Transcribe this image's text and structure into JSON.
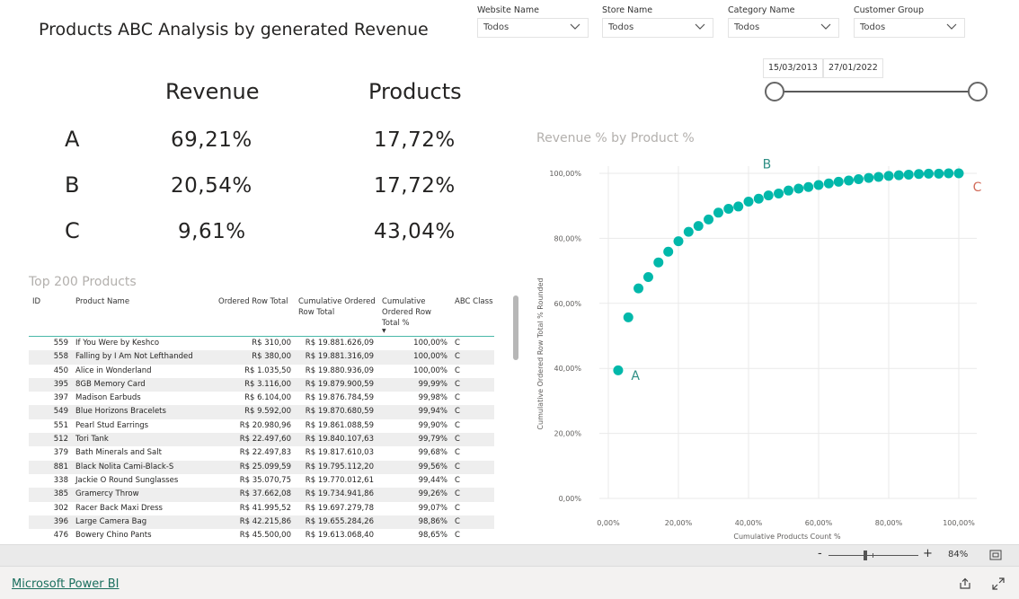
{
  "report": {
    "title": "Products ABC Analysis by generated Revenue"
  },
  "slicers": [
    {
      "label": "Website Name",
      "value": "Todos"
    },
    {
      "label": "Store Name",
      "value": "Todos"
    },
    {
      "label": "Category Name",
      "value": "Todos"
    },
    {
      "label": "Customer Group",
      "value": "Todos"
    }
  ],
  "date_range": {
    "start": "15/03/2013",
    "end": "27/01/2022"
  },
  "kpis": {
    "revenue_header": "Revenue",
    "products_header": "Products",
    "rows": [
      {
        "class": "A",
        "revenue": "69,21%",
        "products": "17,72%"
      },
      {
        "class": "B",
        "revenue": "20,54%",
        "products": "17,72%"
      },
      {
        "class": "C",
        "revenue": "9,61%",
        "products": "43,04%"
      }
    ]
  },
  "table": {
    "title": "Top 200 Products",
    "columns": {
      "id": "ID",
      "name": "Product Name",
      "ordered": "Ordered Row Total",
      "cum_line1": "Cumulative Ordered",
      "cum_line2": "Row Total",
      "pct_line1": "Cumulative",
      "pct_line2": "Ordered Row",
      "pct_line3": "Total %",
      "class": "ABC Class"
    },
    "rows": [
      {
        "id": "559",
        "name": "If You Were by Keshco",
        "ordered": "R$ 310,00",
        "cum": "R$ 19.881.626,09",
        "pct": "100,00%",
        "class": "C"
      },
      {
        "id": "558",
        "name": "Falling by I Am Not Lefthanded",
        "ordered": "R$ 380,00",
        "cum": "R$ 19.881.316,09",
        "pct": "100,00%",
        "class": "C"
      },
      {
        "id": "450",
        "name": "Alice in Wonderland",
        "ordered": "R$ 1.035,50",
        "cum": "R$ 19.880.936,09",
        "pct": "100,00%",
        "class": "C"
      },
      {
        "id": "395",
        "name": "8GB Memory Card",
        "ordered": "R$ 3.116,00",
        "cum": "R$ 19.879.900,59",
        "pct": "99,99%",
        "class": "C"
      },
      {
        "id": "397",
        "name": "Madison Earbuds",
        "ordered": "R$ 6.104,00",
        "cum": "R$ 19.876.784,59",
        "pct": "99,98%",
        "class": "C"
      },
      {
        "id": "549",
        "name": "Blue Horizons Bracelets",
        "ordered": "R$ 9.592,00",
        "cum": "R$ 19.870.680,59",
        "pct": "99,94%",
        "class": "C"
      },
      {
        "id": "551",
        "name": "Pearl Stud Earrings",
        "ordered": "R$ 20.980,96",
        "cum": "R$ 19.861.088,59",
        "pct": "99,90%",
        "class": "C"
      },
      {
        "id": "512",
        "name": "Tori Tank",
        "ordered": "R$ 22.497,60",
        "cum": "R$ 19.840.107,63",
        "pct": "99,79%",
        "class": "C"
      },
      {
        "id": "379",
        "name": "Bath Minerals and Salt",
        "ordered": "R$ 22.497,83",
        "cum": "R$ 19.817.610,03",
        "pct": "99,68%",
        "class": "C"
      },
      {
        "id": "881",
        "name": "Black Nolita Cami-Black-S",
        "ordered": "R$ 25.099,59",
        "cum": "R$ 19.795.112,20",
        "pct": "99,56%",
        "class": "C"
      },
      {
        "id": "338",
        "name": "Jackie O Round Sunglasses",
        "ordered": "R$ 35.070,75",
        "cum": "R$ 19.770.012,61",
        "pct": "99,44%",
        "class": "C"
      },
      {
        "id": "385",
        "name": "Gramercy Throw",
        "ordered": "R$ 37.662,08",
        "cum": "R$ 19.734.941,86",
        "pct": "99,26%",
        "class": "C"
      },
      {
        "id": "302",
        "name": "Racer Back Maxi Dress",
        "ordered": "R$ 41.995,52",
        "cum": "R$ 19.697.279,78",
        "pct": "99,07%",
        "class": "C"
      },
      {
        "id": "396",
        "name": "Large Camera Bag",
        "ordered": "R$ 42.215,86",
        "cum": "R$ 19.655.284,26",
        "pct": "98,86%",
        "class": "C"
      },
      {
        "id": "476",
        "name": "Bowery Chino Pants",
        "ordered": "R$ 45.500,00",
        "cum": "R$ 19.613.068,40",
        "pct": "98,65%",
        "class": "C"
      }
    ]
  },
  "chart_data": {
    "type": "scatter",
    "title": "Revenue % by Product %",
    "xlabel": "Cumulative Products Count %",
    "ylabel": "Cumulative Ordered Row Total % Rounded",
    "xlim": [
      0,
      100
    ],
    "ylim": [
      0,
      100
    ],
    "x_ticks": [
      "0,00%",
      "20,00%",
      "40,00%",
      "60,00%",
      "80,00%",
      "100,00%"
    ],
    "y_ticks": [
      "0,00%",
      "20,00%",
      "40,00%",
      "60,00%",
      "80,00%",
      "100,00%"
    ],
    "grid": true,
    "color": "#01b8aa",
    "points": [
      [
        2.8,
        39.4
      ],
      [
        5.7,
        55.7
      ],
      [
        8.6,
        64.6
      ],
      [
        11.4,
        68.1
      ],
      [
        14.3,
        72.6
      ],
      [
        17.1,
        75.9
      ],
      [
        20.0,
        79.1
      ],
      [
        22.9,
        82.0
      ],
      [
        25.7,
        83.8
      ],
      [
        28.6,
        85.8
      ],
      [
        31.4,
        87.9
      ],
      [
        34.3,
        89.1
      ],
      [
        37.1,
        89.8
      ],
      [
        40.0,
        91.3
      ],
      [
        42.9,
        92.2
      ],
      [
        45.7,
        93.2
      ],
      [
        48.6,
        93.8
      ],
      [
        51.4,
        94.7
      ],
      [
        54.3,
        95.3
      ],
      [
        57.1,
        95.8
      ],
      [
        60.0,
        96.4
      ],
      [
        62.9,
        96.9
      ],
      [
        65.7,
        97.4
      ],
      [
        68.6,
        97.8
      ],
      [
        71.4,
        98.2
      ],
      [
        74.3,
        98.6
      ],
      [
        77.1,
        98.9
      ],
      [
        80.0,
        99.2
      ],
      [
        82.9,
        99.4
      ],
      [
        85.7,
        99.6
      ],
      [
        88.6,
        99.8
      ],
      [
        91.4,
        99.9
      ],
      [
        94.3,
        99.9
      ],
      [
        97.1,
        100.0
      ],
      [
        100.0,
        100.0
      ]
    ],
    "annotations": [
      {
        "text": "A",
        "x": 6.5,
        "y": 36.5,
        "color": "#2f8f85"
      },
      {
        "text": "B",
        "x": 44.0,
        "y": 101.5,
        "color": "#2f8f85"
      },
      {
        "text": "C",
        "x": 104.0,
        "y": 94.5,
        "color": "#d26c5a"
      }
    ]
  },
  "status": {
    "zoom_minus": "-",
    "zoom_plus": "+",
    "zoom_level": "84%"
  },
  "footer": {
    "brand": "Microsoft Power BI"
  }
}
